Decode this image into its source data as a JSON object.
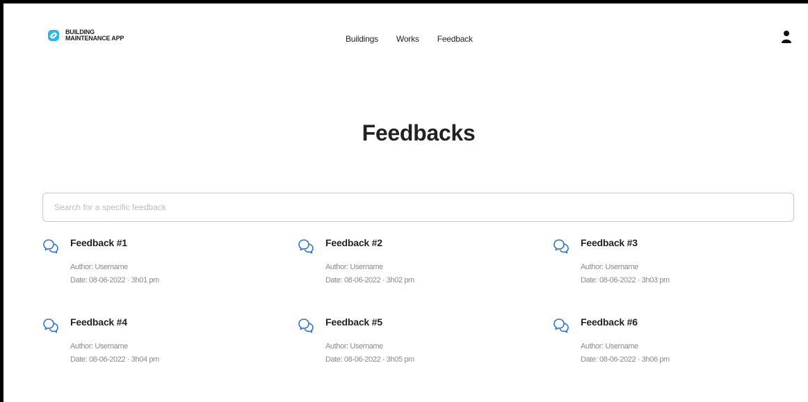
{
  "app": {
    "logo_line1": "BUILDING",
    "logo_line2": "MAINTENANCE APP",
    "accent_color": "#29b6e8"
  },
  "nav": {
    "items": [
      {
        "label": "Buildings"
      },
      {
        "label": "Works"
      },
      {
        "label": "Feedback"
      }
    ]
  },
  "header": {
    "user_icon": "user-icon"
  },
  "main": {
    "title": "Feedbacks",
    "search": {
      "placeholder": "Search for a specific feedback",
      "value": ""
    },
    "feedbacks": [
      {
        "title": "Feedback #1",
        "author": "Author: Username",
        "date": "Date: 08-06-2022 · 3h01 pm",
        "icon": "chat-bubbles-icon"
      },
      {
        "title": "Feedback #2",
        "author": "Author: Username",
        "date": "Date: 08-06-2022 · 3h02 pm",
        "icon": "chat-bubbles-icon"
      },
      {
        "title": "Feedback #3",
        "author": "Author: Username",
        "date": "Date: 08-06-2022 · 3h03 pm",
        "icon": "chat-bubbles-icon"
      },
      {
        "title": "Feedback #4",
        "author": "Author: Username",
        "date": "Date: 08-06-2022 · 3h04 pm",
        "icon": "chat-bubbles-icon"
      },
      {
        "title": "Feedback #5",
        "author": "Author: Username",
        "date": "Date: 08-06-2022 · 3h05 pm",
        "icon": "chat-bubbles-icon"
      },
      {
        "title": "Feedback #6",
        "author": "Author: Username",
        "date": "Date: 08-06-2022 · 3h06 pm",
        "icon": "chat-bubbles-icon"
      }
    ]
  }
}
